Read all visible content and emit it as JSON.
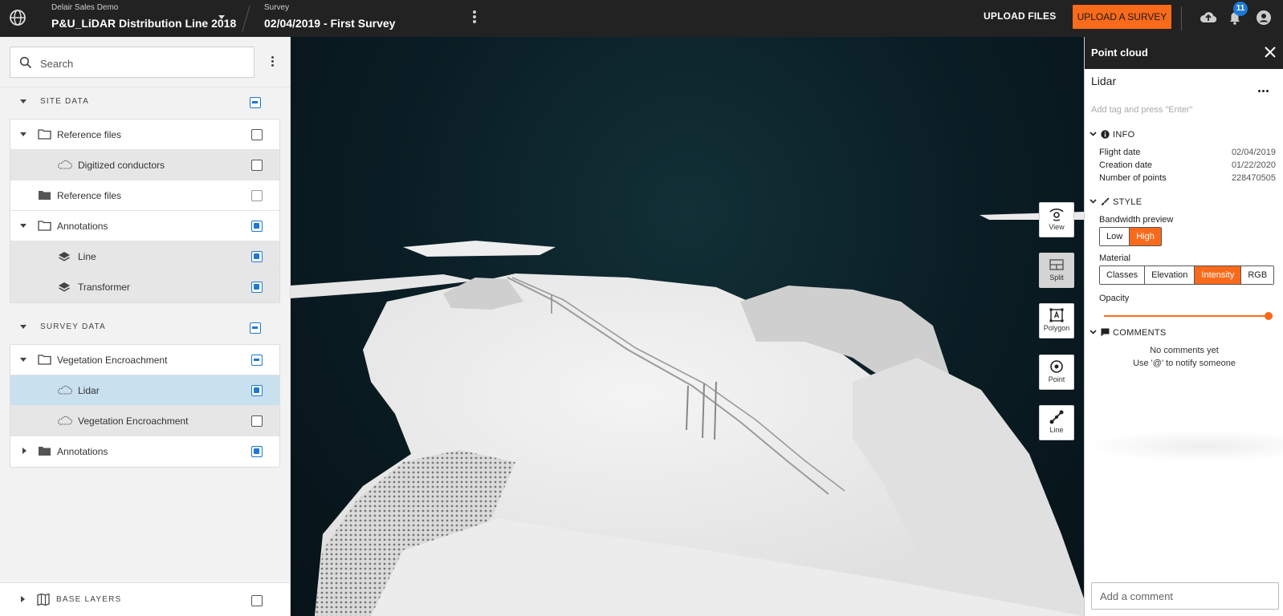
{
  "header": {
    "project_label": "Delair Sales Demo",
    "project_name": "P&U_LiDAR Distribution Line 2018",
    "survey_label": "Survey",
    "survey_name": "02/04/2019 - First Survey",
    "upload_files": "UPLOAD FILES",
    "upload_survey": "UPLOAD A SURVEY",
    "notification_count": "11",
    "accent_color": "#f96a1b",
    "badge_color": "#1e78d6"
  },
  "left_panel": {
    "search_placeholder": "Search",
    "site_data": {
      "label": "SITE DATA",
      "rows": [
        {
          "label": "Reference files",
          "icon": "folder-outline-icon",
          "checked": false
        },
        {
          "label": "Digitized conductors",
          "icon": "cloud-icon",
          "checked": false
        },
        {
          "label": "Reference files",
          "icon": "folder-filled-icon",
          "checked": false
        },
        {
          "label": "Annotations",
          "icon": "folder-outline-icon",
          "checked": true
        },
        {
          "label": "Line",
          "icon": "layers-icon",
          "checked": true
        },
        {
          "label": "Transformer",
          "icon": "layers-icon",
          "checked": true
        }
      ]
    },
    "survey_data": {
      "label": "SURVEY DATA",
      "rows": [
        {
          "label": "Vegetation Encroachment",
          "icon": "folder-outline-icon",
          "checked": "mixed"
        },
        {
          "label": "Lidar",
          "icon": "cloud-icon",
          "checked": true,
          "selected": true
        },
        {
          "label": "Vegetation Encroachment",
          "icon": "cloud-icon",
          "checked": false
        },
        {
          "label": "Annotations",
          "icon": "folder-filled-icon",
          "checked": true
        }
      ]
    },
    "base_layers": "BASE LAYERS"
  },
  "viewport": {
    "tools": [
      {
        "label": "View",
        "icon": "view-icon"
      },
      {
        "label": "Split",
        "icon": "split-icon",
        "active": true
      },
      {
        "label": "Polygon",
        "icon": "polygon-icon"
      },
      {
        "label": "Point",
        "icon": "point-icon"
      },
      {
        "label": "Line",
        "icon": "line-icon"
      }
    ]
  },
  "right_panel": {
    "title": "Point cloud",
    "name": "Lidar",
    "tag_placeholder": "Add tag and press \"Enter\"",
    "info_label": "INFO",
    "info": [
      {
        "key": "Flight date",
        "value": "02/04/2019"
      },
      {
        "key": "Creation date",
        "value": "01/22/2020"
      },
      {
        "key": "Number of points",
        "value": "228470505"
      }
    ],
    "style_label": "STYLE",
    "bandwidth_label": "Bandwidth preview",
    "bandwidth_options": [
      "Low",
      "High"
    ],
    "bandwidth_selected": "High",
    "material_label": "Material",
    "material_options": [
      "Classes",
      "Elevation",
      "Intensity",
      "RGB"
    ],
    "material_selected": "Intensity",
    "opacity_label": "Opacity",
    "opacity_value": 1.0,
    "comments_label": "COMMENTS",
    "no_comments": "No comments yet",
    "notify_hint": "Use '@' to notify someone",
    "comment_placeholder": "Add a comment"
  }
}
